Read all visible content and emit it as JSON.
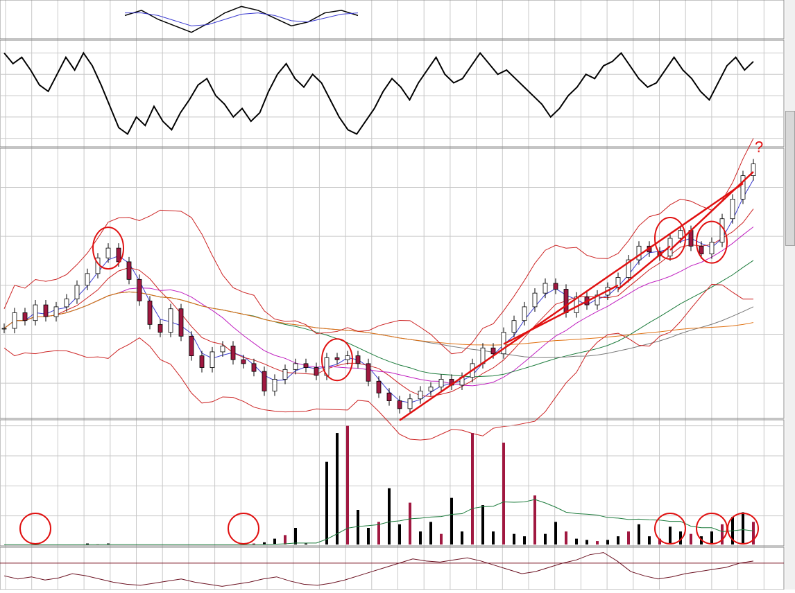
{
  "chart_data": [
    {
      "type": "line",
      "panel": "oscillator-top",
      "y_ticks": [
        "-.50"
      ],
      "series": [
        {
          "values": [
            -0.42,
            -0.38,
            -0.45,
            -0.5,
            -0.55,
            -0.48,
            -0.4,
            -0.35,
            -0.38,
            -0.44,
            -0.5,
            -0.47,
            -0.4,
            -0.38,
            -0.42
          ],
          "color": "#000000"
        },
        {
          "values": [
            -0.4,
            -0.4,
            -0.42,
            -0.46,
            -0.5,
            -0.49,
            -0.45,
            -0.41,
            -0.4,
            -0.42,
            -0.46,
            -0.47,
            -0.44,
            -0.41,
            -0.4
          ],
          "color": "#3a3ad0"
        }
      ]
    },
    {
      "type": "line",
      "panel": "momentum",
      "ylim": [
        -24,
        26
      ],
      "y_ticks": [
        "20",
        "10",
        "0",
        "-10",
        "-20"
      ],
      "series": [
        {
          "color": "#000000",
          "values": [
            20,
            15,
            18,
            12,
            5,
            2,
            10,
            18,
            12,
            20,
            14,
            5,
            -5,
            -15,
            -18,
            -10,
            -14,
            -5,
            -12,
            -16,
            -8,
            -2,
            5,
            8,
            0,
            -4,
            -10,
            -6,
            -12,
            -8,
            2,
            10,
            15,
            8,
            4,
            10,
            6,
            -2,
            -10,
            -16,
            -18,
            -12,
            -6,
            2,
            8,
            4,
            -2,
            6,
            12,
            18,
            10,
            6,
            8,
            14,
            20,
            15,
            10,
            12,
            8,
            4,
            0,
            -4,
            -10,
            -6,
            0,
            4,
            10,
            8,
            14,
            16,
            20,
            14,
            8,
            4,
            6,
            12,
            18,
            12,
            8,
            2,
            -2,
            6,
            14,
            18,
            12,
            16
          ]
        }
      ]
    },
    {
      "type": "candlestick",
      "panel": "price",
      "ylim": [
        8.2,
        22.0
      ],
      "y_ticks": [
        "20.0",
        "17.5",
        "15.0",
        "12.5",
        "10.0"
      ],
      "annotation": "?",
      "close": [
        12.8,
        13.6,
        13.2,
        14.0,
        13.4,
        13.9,
        14.3,
        15.0,
        15.6,
        16.4,
        16.9,
        16.2,
        15.3,
        14.2,
        13.0,
        12.6,
        13.8,
        12.4,
        11.4,
        10.8,
        11.6,
        11.9,
        11.2,
        11.0,
        10.6,
        9.6,
        10.2,
        10.7,
        11.0,
        10.8,
        10.4,
        11.3,
        11.2,
        11.4,
        11.0,
        10.1,
        9.5,
        9.1,
        8.7,
        9.2,
        9.6,
        9.8,
        10.2,
        9.9,
        10.3,
        11.0,
        11.8,
        11.5,
        12.6,
        13.2,
        13.9,
        14.6,
        15.1,
        14.8,
        13.6,
        14.4,
        14.0,
        14.5,
        14.9,
        15.4,
        16.3,
        17.0,
        16.7,
        16.5,
        17.4,
        17.8,
        17.0,
        16.6,
        17.2,
        18.4,
        19.4,
        20.6,
        21.2
      ],
      "overlays": [
        {
          "name": "",
          "color": "#3a3ad0"
        },
        {
          "name": "",
          "color": "#cc2222"
        },
        {
          "name": "",
          "color": "#c020c0"
        },
        {
          "name": "",
          "color": "#1a7a3a"
        },
        {
          "name": "",
          "color": "#777777"
        },
        {
          "name": "",
          "color": "#e07010"
        }
      ]
    },
    {
      "type": "bar",
      "panel": "volume",
      "ylim": [
        0,
        10.5
      ],
      "y_ticks": [
        "10.0M",
        "7.5M",
        "5.0M",
        "2.5M"
      ],
      "values": [
        0.1,
        0.1,
        0.1,
        0.05,
        0.1,
        0.1,
        0.08,
        0.1,
        0.2,
        0.15,
        0.2,
        0.1,
        0.1,
        0.05,
        0.05,
        0.1,
        0.08,
        0.06,
        0.05,
        0.05,
        0.1,
        0.1,
        0.1,
        0.08,
        0.2,
        0.3,
        0.6,
        0.9,
        1.5,
        0.2,
        0.1,
        7.0,
        9.4,
        10.0,
        3.0,
        1.5,
        2.0,
        4.8,
        1.8,
        3.6,
        1.2,
        2.0,
        1.0,
        4.0,
        1.2,
        9.4,
        3.4,
        1.2,
        8.6,
        1.0,
        0.8,
        4.2,
        1.0,
        2.0,
        1.2,
        0.6,
        0.5,
        0.4,
        0.5,
        0.8,
        1.2,
        1.8,
        0.8,
        0.6,
        1.6,
        1.2,
        1.0,
        0.8,
        1.2,
        1.8,
        2.4,
        2.8,
        2.0
      ]
    },
    {
      "type": "area",
      "panel": "rsi",
      "y_ticks": [
        "70",
        "50"
      ],
      "values": [
        58,
        55,
        57,
        54,
        56,
        60,
        58,
        55,
        52,
        50,
        49,
        51,
        53,
        55,
        52,
        50,
        48,
        50,
        52,
        55,
        57,
        53,
        50,
        49,
        51,
        54,
        58,
        62,
        66,
        70,
        74,
        72,
        71,
        73,
        75,
        72,
        68,
        64,
        60,
        62,
        66,
        70,
        73,
        78,
        80,
        72,
        62,
        58,
        55,
        57,
        60,
        62,
        64,
        66,
        70,
        72
      ]
    }
  ]
}
